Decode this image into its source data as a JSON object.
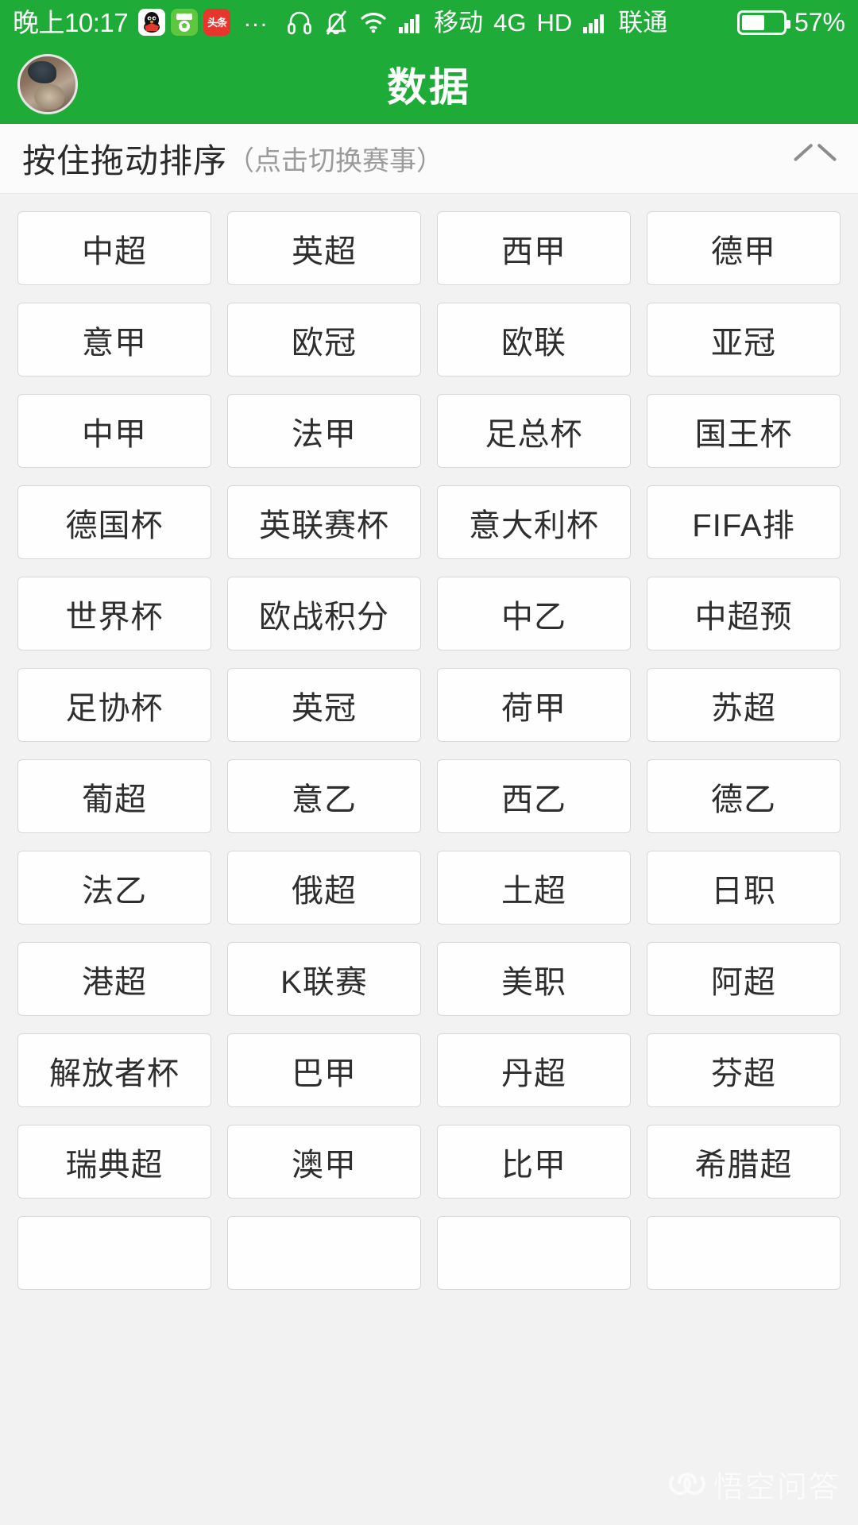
{
  "status_bar": {
    "time": "晚上10:17",
    "app_icons": [
      {
        "name": "qq-icon",
        "label": ""
      },
      {
        "name": "football-app-icon",
        "label": ""
      },
      {
        "name": "toutiao-icon",
        "label": "头条"
      }
    ],
    "overflow": "...",
    "carrier_primary": "移动",
    "network_type": "4G",
    "hd_label": "HD",
    "carrier_secondary": "联通",
    "battery_percent": "57%",
    "battery_level": 57,
    "icons": [
      "headset-icon",
      "bell-muted-icon",
      "wifi-icon",
      "signal-icon",
      "signal-icon"
    ]
  },
  "app_bar": {
    "title": "数据",
    "avatar_name": "user-avatar"
  },
  "sort_bar": {
    "main_label": "按住拖动排序",
    "sub_label": "（点击切换赛事）",
    "collapse_icon": "chevron-up-icon"
  },
  "colors": {
    "brand_green": "#1fab38",
    "page_background": "#f2f2f2",
    "cell_background": "#fefefe",
    "cell_border": "#d8d8d8",
    "text_primary": "#2e2e2e",
    "text_muted": "#9b9b9b"
  },
  "leagues": {
    "columns": 4,
    "items": [
      "中超",
      "英超",
      "西甲",
      "德甲",
      "意甲",
      "欧冠",
      "欧联",
      "亚冠",
      "中甲",
      "法甲",
      "足总杯",
      "国王杯",
      "德国杯",
      "英联赛杯",
      "意大利杯",
      "FIFA排",
      "世界杯",
      "欧战积分",
      "中乙",
      "中超预",
      "足协杯",
      "英冠",
      "荷甲",
      "苏超",
      "葡超",
      "意乙",
      "西乙",
      "德乙",
      "法乙",
      "俄超",
      "土超",
      "日职",
      "港超",
      "K联赛",
      "美职",
      "阿超",
      "解放者杯",
      "巴甲",
      "丹超",
      "芬超",
      "瑞典超",
      "澳甲",
      "比甲",
      "希腊超",
      "",
      "",
      "",
      ""
    ]
  },
  "watermark": {
    "text": "悟空问答"
  }
}
